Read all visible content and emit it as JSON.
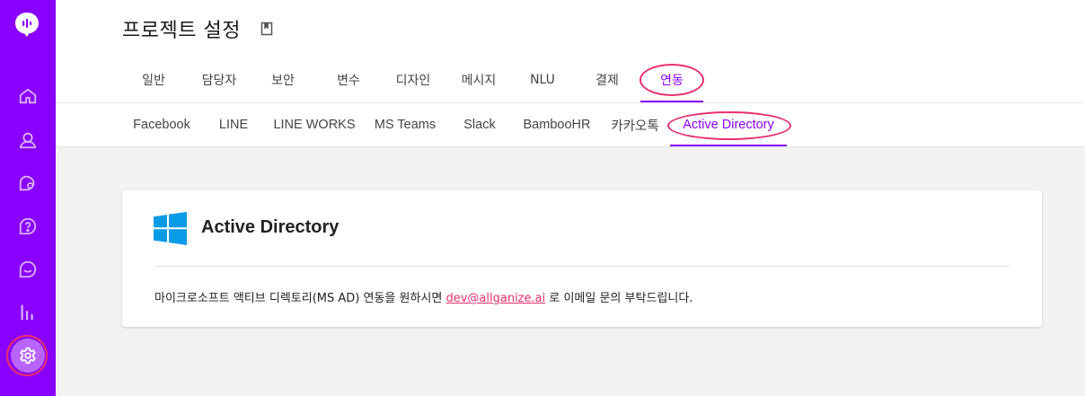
{
  "page": {
    "title": "프로젝트 설정"
  },
  "colors": {
    "brand": "#8a00ff",
    "highlight_ring": "#e8306b",
    "link": "#e8306b"
  },
  "sidebar": {
    "logo": "chat-bubble-logo-icon",
    "items": [
      {
        "icon": "home-icon"
      },
      {
        "icon": "user-icon"
      },
      {
        "icon": "conversation-icon"
      },
      {
        "icon": "help-icon"
      },
      {
        "icon": "chat-icon"
      },
      {
        "icon": "bar-chart-icon"
      },
      {
        "icon": "gear-icon",
        "active": true
      }
    ]
  },
  "main_tabs": [
    {
      "label": "일반"
    },
    {
      "label": "담당자"
    },
    {
      "label": "보안"
    },
    {
      "label": "변수"
    },
    {
      "label": "디자인"
    },
    {
      "label": "메시지"
    },
    {
      "label": "NLU"
    },
    {
      "label": "결제"
    },
    {
      "label": "연동",
      "active": true
    }
  ],
  "sub_tabs": [
    {
      "label": "Facebook"
    },
    {
      "label": "LINE"
    },
    {
      "label": "LINE WORKS"
    },
    {
      "label": "MS Teams"
    },
    {
      "label": "Slack"
    },
    {
      "label": "BambooHR"
    },
    {
      "label": "카카오톡"
    },
    {
      "label": "Active Directory",
      "active": true
    }
  ],
  "card": {
    "title": "Active Directory",
    "body_prefix": "마이크로소프트 액티브 디렉토리(MS AD) 연동을 원하시면 ",
    "email": "dev@allganize.ai",
    "body_suffix": " 로 이메일 문의 부탁드립니다."
  }
}
